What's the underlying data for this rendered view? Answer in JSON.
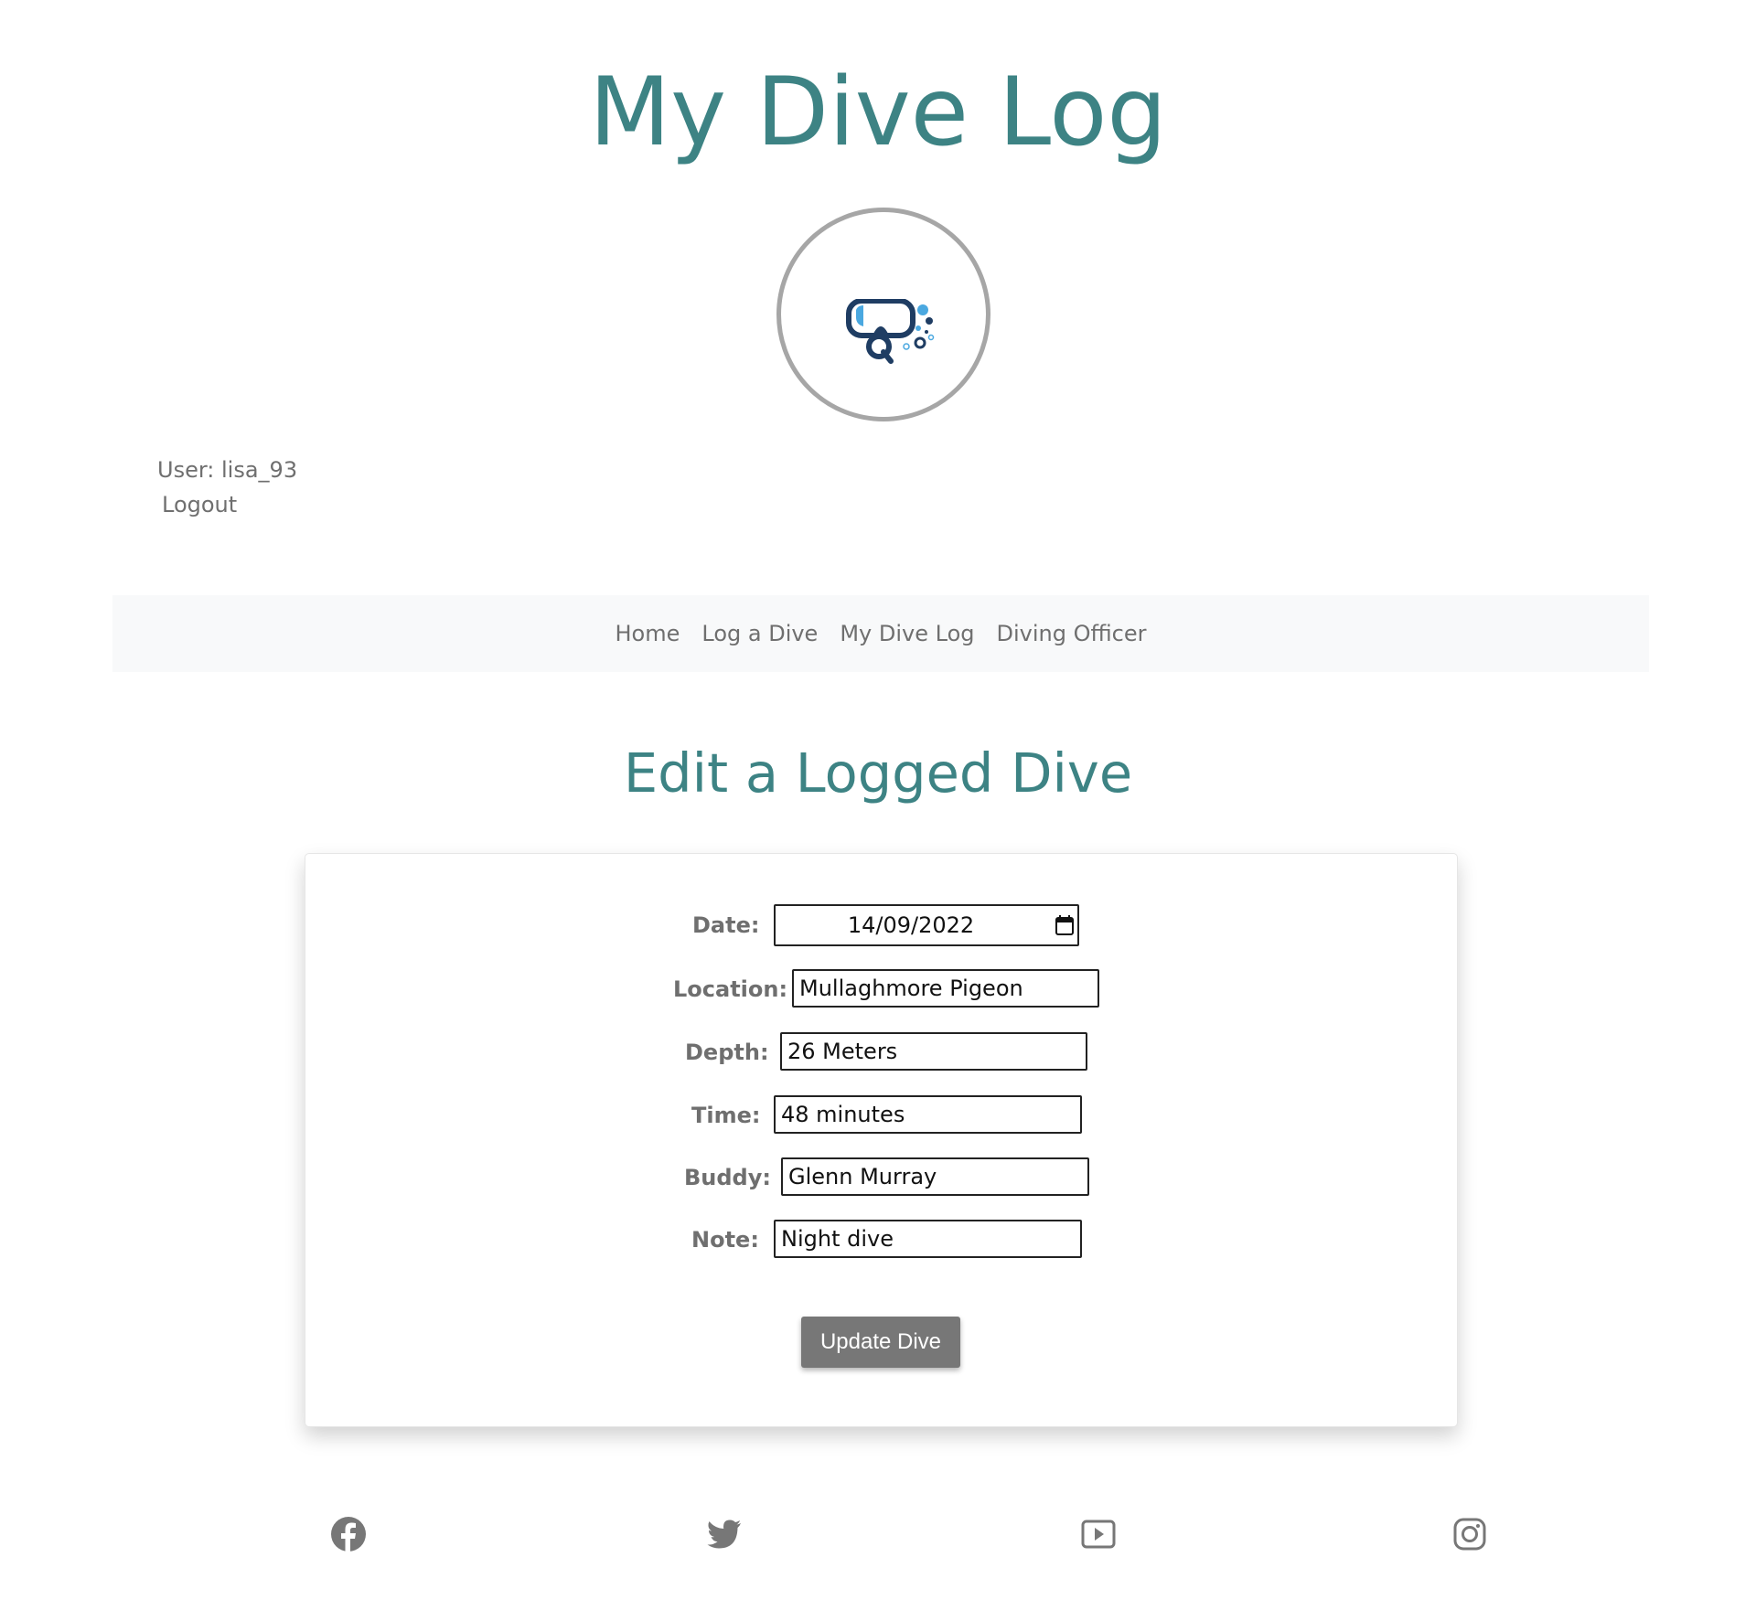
{
  "site": {
    "title": "My Dive Log"
  },
  "user": {
    "label": "User: lisa_93",
    "logout": "Logout"
  },
  "nav": {
    "items": [
      {
        "label": "Home"
      },
      {
        "label": "Log a Dive"
      },
      {
        "label": "My Dive Log"
      },
      {
        "label": "Diving Officer"
      }
    ]
  },
  "main": {
    "heading": "Edit a Logged Dive"
  },
  "form": {
    "date": {
      "label": "Date:",
      "value": "14/09/2022"
    },
    "location": {
      "label": "Location:",
      "value": "Mullaghmore Pigeon"
    },
    "depth": {
      "label": "Depth:",
      "value": "26 Meters"
    },
    "time": {
      "label": "Time:",
      "value": "48 minutes"
    },
    "buddy": {
      "label": "Buddy:",
      "value": "Glenn Murray"
    },
    "note": {
      "label": "Note:",
      "value": "Night dive"
    },
    "submit_label": "Update Dive"
  },
  "footer": {
    "icons": [
      "facebook-icon",
      "twitter-icon",
      "youtube-icon",
      "instagram-icon"
    ]
  },
  "colors": {
    "heading": "#3d8384",
    "text_muted": "#6f6f6f",
    "button": "#777777",
    "nav_bg": "#f8f9fa",
    "logo_dark": "#1f3d63",
    "logo_light": "#4aa8e0"
  }
}
